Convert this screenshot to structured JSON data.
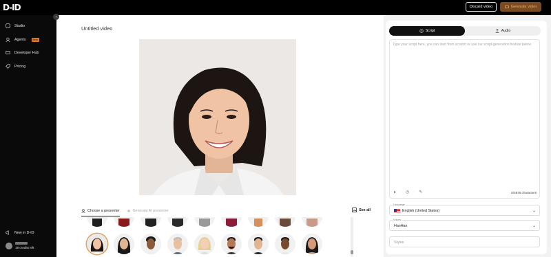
{
  "app": {
    "logo_text": "D-ID"
  },
  "header": {
    "discard_label": "Discard video",
    "generate_label": "Generate video"
  },
  "sidebar": {
    "items": [
      {
        "label": "Studio",
        "icon": "home-icon"
      },
      {
        "label": "Agents",
        "icon": "agents-icon",
        "badge": "Beta"
      },
      {
        "label": "Developer Hub",
        "icon": "code-icon"
      },
      {
        "label": "Pricing",
        "icon": "tag-icon"
      }
    ],
    "new_in": "New in D-ID",
    "credits": "19 credits left"
  },
  "main": {
    "video_title": "Untitled video",
    "tab_presenter": "Choose a presenter",
    "tab_ai": "Generate AI presenter",
    "see_all": "See all"
  },
  "panel": {
    "tab_script": "Script",
    "tab_audio": "Audio",
    "script_placeholder": "Type your script here, you can start from scratch or use our script-generation feature below.",
    "counter": "0/3875 characters",
    "language_label": "Language",
    "language_value": "English (United States)",
    "voices_label": "Voices",
    "voices_value": "HanHan",
    "styles_placeholder": "Styles"
  },
  "colors": {
    "accent": "#7a4a22",
    "accent_text": "#f2b36a",
    "beta": "#e07a2f"
  }
}
